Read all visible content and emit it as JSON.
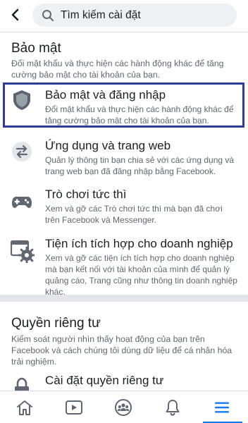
{
  "header": {
    "search_value": "Tìm kiếm cài đặt"
  },
  "security_section": {
    "title": "Bảo mật",
    "description": "Đổi mật khẩu và thực hiện các hành động khác để tăng cường bảo mật cho tài khoản của bạn.",
    "items": [
      {
        "title": "Bảo mật và đăng nhập",
        "description": "Đổi mật khẩu và thực hiện các hành động khác để tăng cường bảo mật cho tài khoản của bạn.",
        "icon": "shield-icon"
      },
      {
        "title": "Ứng dụng và trang web",
        "description": "Quản lý thông tin bạn chia sẻ với các ứng dụng và trang web bạn đã đăng nhập bằng Facebook.",
        "icon": "apps-arrows-icon"
      },
      {
        "title": "Trò chơi tức thì",
        "description": "Xem và gỡ các Trò chơi tức thì mà bạn đã chơi trên Facebook và Messenger.",
        "icon": "gamepad-icon"
      },
      {
        "title": "Tiện ích tích hợp cho doanh nghiệp",
        "description": "Xem và gỡ các tiện ích tích hợp cho doanh nghiệp mà bạn kết nối với tài khoản của mình để quản lý quảng cáo, Trang cũng như thông tin doanh nghiệp khác.",
        "icon": "business-integration-gear-icon"
      }
    ]
  },
  "privacy_section": {
    "title": "Quyền riêng tư",
    "description": "Kiểm soát người nhìn thấy hoạt động của bạn trên Facebook và cách chúng tôi dùng dữ liệu để cá nhân hóa trải nghiệm.",
    "items": [
      {
        "title": "Cài đặt quyền riêng tư",
        "icon": "lock-icon"
      }
    ]
  },
  "bottom_nav": {
    "tabs": [
      "home-icon",
      "watch-icon",
      "groups-icon",
      "notifications-bell-icon",
      "menu-icon"
    ],
    "active_tab": "menu-icon",
    "active_color": "#1877f2",
    "highlight_color": "#2f3c9a"
  }
}
